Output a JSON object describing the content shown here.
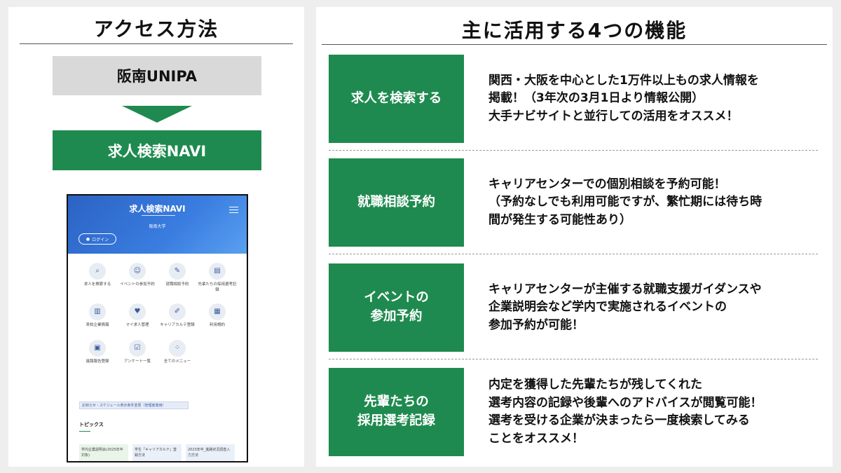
{
  "left": {
    "title": "アクセス方法",
    "step1": "阪南UNIPA",
    "step2": "求人検索NAVI",
    "phone": {
      "app_title": "求人検索NAVI",
      "subtitle": "阪南大学",
      "login": "ログイン",
      "menu": [
        {
          "label": "求人を検索する",
          "icon": "search-icon"
        },
        {
          "label": "イベントの参加予約",
          "icon": "people-icon"
        },
        {
          "label": "就職相談予約",
          "icon": "consult-icon"
        },
        {
          "label": "先輩たちの採用選考記録",
          "icon": "record-icon"
        },
        {
          "label": "来校企業情報",
          "icon": "building-icon"
        },
        {
          "label": "マイ求人管理",
          "icon": "bookmark-icon"
        },
        {
          "label": "キャリアカルテ登録",
          "icon": "edit-icon"
        },
        {
          "label": "利用規約",
          "icon": "document-icon"
        },
        {
          "label": "進路報告登録",
          "icon": "report-icon"
        },
        {
          "label": "アンケート一覧",
          "icon": "survey-icon"
        },
        {
          "label": "全てのメニュー",
          "icon": "grid-icon"
        }
      ],
      "notice": "お知らせ・スケジュール表示条件変更（管理者専用）",
      "topics_heading": "トピックス",
      "topics": [
        "学内企業説明会(2025年卒対象)",
        "学生「キャリアカルテ」登録方法",
        "2023年卒_進路状況調査入力方法"
      ]
    }
  },
  "right": {
    "title": "主に活用する4つの機能",
    "features": [
      {
        "label": "求人を検索する",
        "desc": "関西・大阪を中心とした1万件以上もの求人情報を\n掲載！（3年次の3月1日より情報公開）\n大手ナビサイトと並行しての活用をオススメ！"
      },
      {
        "label": "就職相談予約",
        "desc": "キャリアセンターでの個別相談を予約可能！\n（予約なしでも利用可能ですが、繁忙期には待ち時\n間が発生する可能性あり）"
      },
      {
        "label": "イベントの\n参加予約",
        "desc": "キャリアセンターが主催する就職支援ガイダンスや\n企業説明会など学内で実施されるイベントの\n参加予約が可能！"
      },
      {
        "label": "先輩たちの\n採用選考記録",
        "desc": "内定を獲得した先輩たちが残してくれた\n選考内容の記録や後輩へのアドバイスが閲覧可能！\n選考を受ける企業が決まったら一度検索してみる\nことをオススメ！"
      }
    ]
  },
  "colors": {
    "accent_green": "#1f8a4f",
    "gray_box": "#d9d9d9",
    "phone_blue": "#2b63c4"
  }
}
